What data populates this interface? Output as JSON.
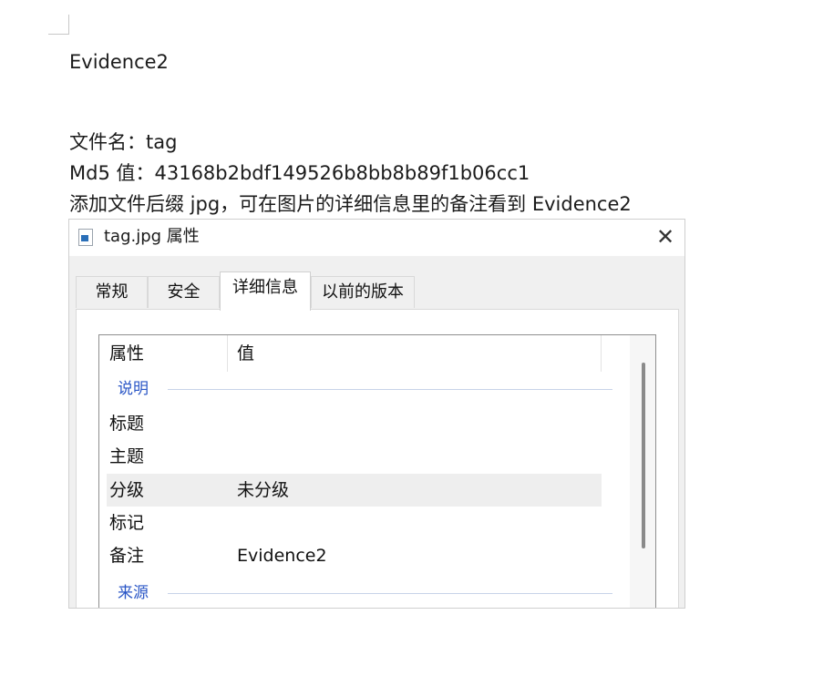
{
  "document": {
    "heading": "Evidence2",
    "lines": [
      "文件名：tag",
      "Md5 值：43168b2bdf149526b8bb8b89f1b06cc1",
      "添加文件后缀 jpg，可在图片的详细信息里的备注看到 Evidence2"
    ]
  },
  "dialog": {
    "title": "tag.jpg 属性",
    "close_glyph": "✕",
    "tabs": [
      {
        "label": "常规"
      },
      {
        "label": "安全"
      },
      {
        "label": "详细信息"
      },
      {
        "label": "以前的版本"
      }
    ],
    "active_tab": "详细信息",
    "columns": {
      "property": "属性",
      "value": "值"
    },
    "groups": [
      "说明",
      "来源"
    ],
    "rows": [
      {
        "name": "标题",
        "value": ""
      },
      {
        "name": "主题",
        "value": ""
      },
      {
        "name": "分级",
        "value": "未分级"
      },
      {
        "name": "标记",
        "value": ""
      },
      {
        "name": "备注",
        "value": "Evidence2"
      }
    ]
  }
}
